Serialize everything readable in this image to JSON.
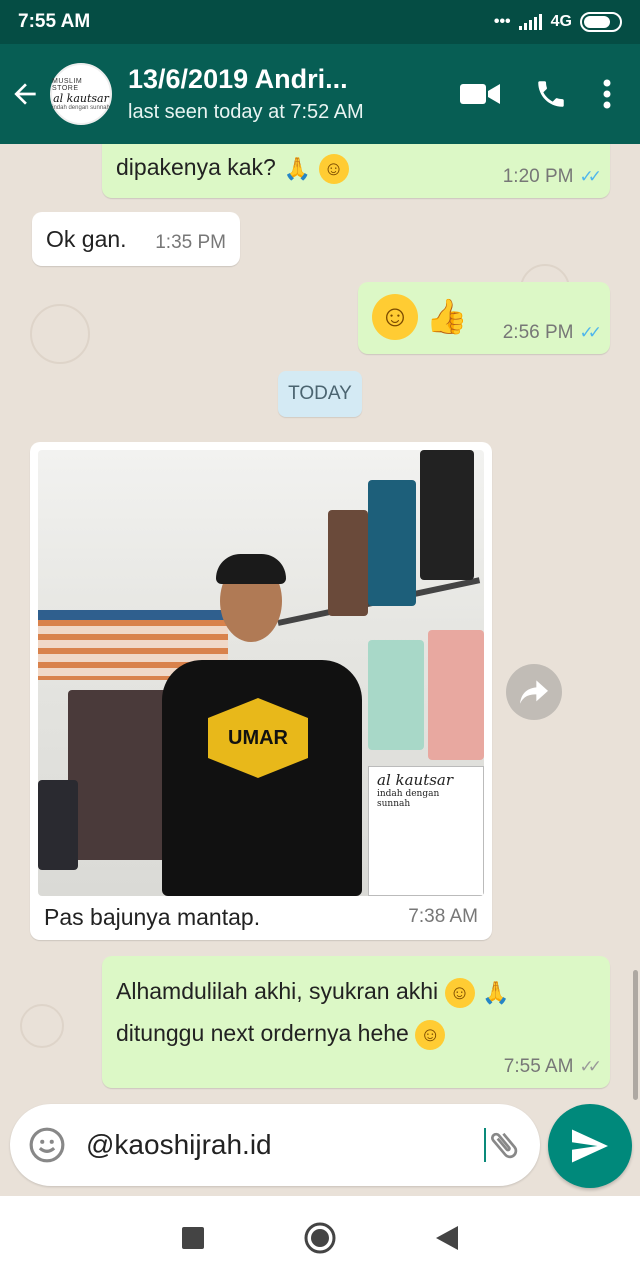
{
  "status_bar": {
    "time": "7:55 AM",
    "network": "4G"
  },
  "header": {
    "contact_name": "13/6/2019 Andri...",
    "last_seen": "last seen today at 7:52 AM",
    "avatar_text": {
      "line1": "MUSLIM STORE",
      "line2": "al kautsar",
      "line3": "indah dengan sunnah"
    }
  },
  "messages": [
    {
      "type": "out",
      "text": "dipakenya kak?",
      "time": "1:20 PM",
      "status": "read"
    },
    {
      "type": "in",
      "text": "Ok gan.",
      "time": "1:35 PM"
    },
    {
      "type": "out",
      "text": "",
      "time": "2:56 PM",
      "status": "read"
    },
    {
      "type": "in",
      "caption": "Pas bajunya mantap.",
      "time": "7:38 AM",
      "photo_text": {
        "logo": "UMAR",
        "sign": "al kautsar",
        "sign_sub": "indah dengan sunnah"
      }
    },
    {
      "type": "out",
      "line1": "Alhamdulilah akhi, syukran akhi",
      "line2": "ditunggu next ordernya hehe",
      "time": "7:55 AM",
      "status": "delivered"
    }
  ],
  "date_divider": "TODAY",
  "composer": {
    "value": "@kaoshijrah.id"
  },
  "colors": {
    "header": "#075e54",
    "outgoing": "#dcf8c6",
    "incoming": "#ffffff",
    "send": "#00897b",
    "read_tick": "#4fb6ec"
  }
}
